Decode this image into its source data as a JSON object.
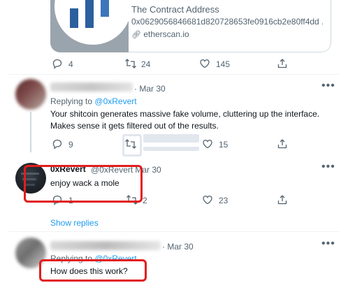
{
  "card": {
    "title": "The Contract Address",
    "address": "0x0629056846681d820728653fe0916cb2e80ff4dd ...",
    "domain": "etherscan.io",
    "logo_colors": [
      "#2b5f9e",
      "#3d76b9"
    ]
  },
  "top_actions": {
    "replies": "4",
    "retweets": "24",
    "likes": "145"
  },
  "reply1": {
    "date": "· Mar 30",
    "replying_prefix": "Replying to",
    "replying_to": "@0xRevert",
    "text_line1": "Your shitcoin generates massive fake volume, cluttering up the interface.",
    "text_line2": "Makes sense it gets filtered out of the results.",
    "replies": "9",
    "likes": "15"
  },
  "reply2": {
    "name": "0xRevert",
    "handle": "@0xRevert",
    "date": "· Mar 30",
    "text": "enjoy wack a mole",
    "replies": "1",
    "retweets": "2",
    "likes": "23"
  },
  "show_replies": "Show replies",
  "reply3": {
    "date": "· Mar 30",
    "replying_prefix": "Replying to",
    "replying_to": "@0xRevert",
    "text": "How does this work?"
  },
  "colors": {
    "link": "#1d9bf0",
    "highlight": "#e11d1d",
    "muted": "#536471"
  }
}
